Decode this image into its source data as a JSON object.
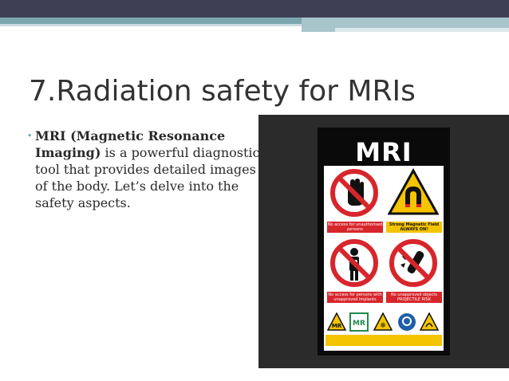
{
  "slide": {
    "title": "7.Radiation safety for MRIs",
    "bullet_bold": "MRI (Magnetic Resonance Imaging)",
    "bullet_rest": " is a powerful diagnostic tool that provides detailed images of the body. Let’s delve into the safety aspects."
  },
  "image": {
    "poster_title": "MRI",
    "signs": [
      {
        "icon": "no-access-hand-icon",
        "caption": "No access for unauthorised persons",
        "color": "#d7262b"
      },
      {
        "icon": "magnetic-field-warning-icon",
        "caption_line1": "Strong Magnetic Field",
        "caption_line2": "ALWAYS ON!",
        "color": "#f4c400"
      },
      {
        "icon": "no-implants-icon",
        "caption": "No access for persons with unapproved implants",
        "color": "#d7262b"
      },
      {
        "icon": "no-objects-icon",
        "caption_line1": "No unapproved objects",
        "caption_line2": "PROJECTILE RISK",
        "color": "#d7262b"
      }
    ],
    "small_signs": [
      {
        "icon": "mr-conditional-icon",
        "label": "MR"
      },
      {
        "icon": "mr-safe-icon",
        "label": "MR"
      },
      {
        "icon": "cryogen-warning-icon",
        "label": ""
      },
      {
        "icon": "ear-protection-icon",
        "label": ""
      },
      {
        "icon": "radiofrequency-warning-icon",
        "label": ""
      }
    ]
  }
}
